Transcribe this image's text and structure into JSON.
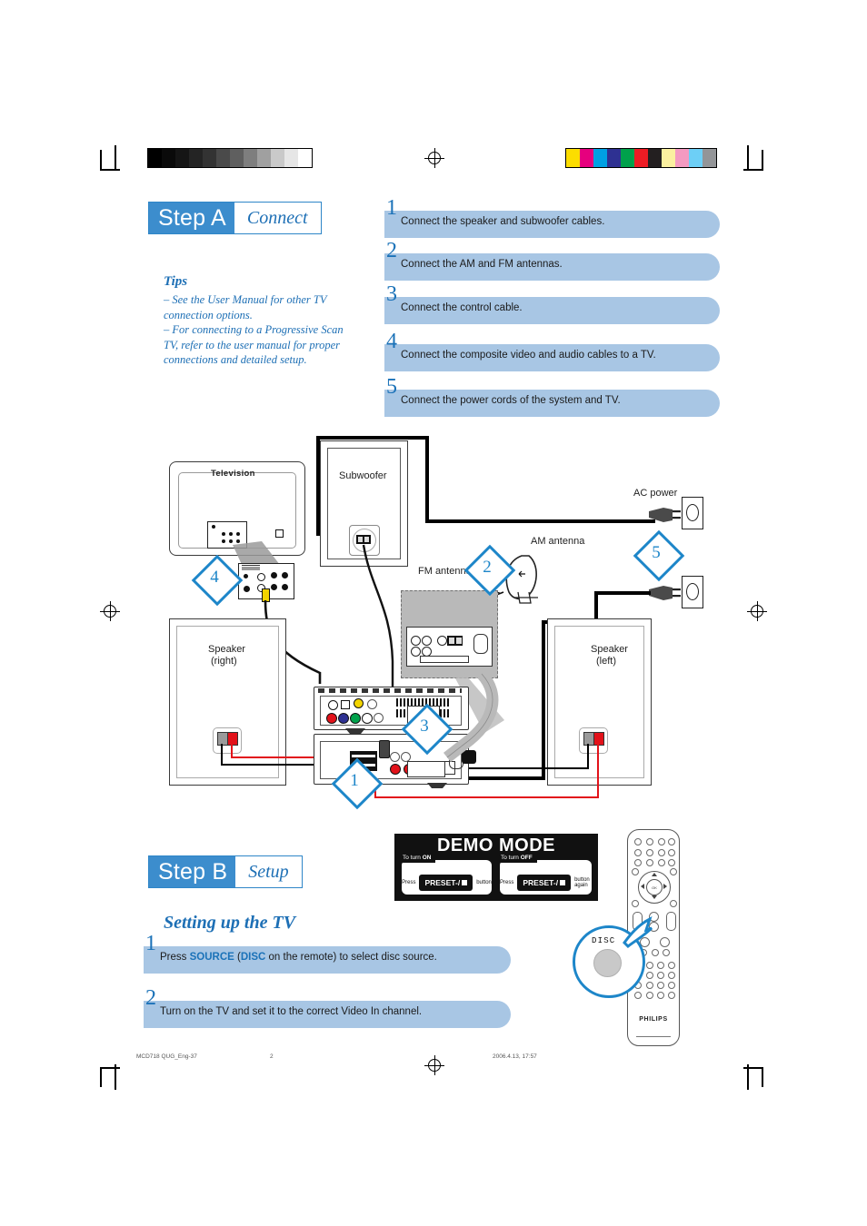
{
  "page": {
    "footer_left": "MCD718 QUG_Eng-37",
    "footer_page": "2",
    "footer_date": "2006.4.13, 17:57"
  },
  "colors": {
    "brand_blue": "#1d6fb5",
    "header_blue": "#3c8dcd",
    "pill_blue": "#a8c6e4",
    "callout_blue": "#1d86c9",
    "wire_red": "#e2121a"
  },
  "calibration": {
    "grayscale": [
      "#000000",
      "#0a0a0a",
      "#151515",
      "#242424",
      "#333333",
      "#4a4a4a",
      "#5f5f5f",
      "#7e7e7e",
      "#a0a0a0",
      "#c9c9c9",
      "#e6e6e6",
      "#ffffff"
    ],
    "colorbars": [
      "#fcdd00",
      "#e6007e",
      "#00a0e3",
      "#2e3192",
      "#00a14b",
      "#ed1c24",
      "#231f20",
      "#fbf0a0",
      "#f49ac1",
      "#6dcff6",
      "#939598"
    ]
  },
  "step_a": {
    "label": "Step A",
    "sub": "Connect",
    "tips_title": "Tips",
    "tips_lines": [
      "–   See the User Manual for other TV",
      "connection options.",
      "–   For connecting to a Progressive Scan",
      "TV, refer to the user manual for proper",
      "connections and detailed setup."
    ],
    "instructions": [
      {
        "num": "1",
        "text": "Connect the speaker and subwoofer cables.",
        "pill_width": 362
      },
      {
        "num": "2",
        "text": "Connect the AM and FM antennas.",
        "pill_width": 362
      },
      {
        "num": "3",
        "text": "Connect the control cable.",
        "pill_width": 362
      },
      {
        "num": "4",
        "text": "Connect the composite video and audio cables to a TV.",
        "pill_width": 362
      },
      {
        "num": "5",
        "text": "Connect the power cords of the system and TV.",
        "pill_width": 362
      }
    ]
  },
  "diagram": {
    "labels": {
      "television": "Television",
      "subwoofer": "Subwoofer",
      "ac_power": "AC power",
      "am_antenna": "AM antenna",
      "fm_antenna": "FM antenna",
      "speaker_right": "Speaker",
      "speaker_right_side": "(right)",
      "speaker_left": "Speaker",
      "speaker_left_side": "(left)"
    },
    "callouts": [
      "1",
      "2",
      "3",
      "4",
      "5"
    ]
  },
  "demo_mode": {
    "title": "DEMO MODE",
    "on": {
      "tag_prefix": "To turn ",
      "tag_state": "ON",
      "press": "Press",
      "key": "PRESET-/",
      "after": "button"
    },
    "off": {
      "tag_prefix": "To turn ",
      "tag_state": "OFF",
      "press": "Press",
      "key": "PRESET-/",
      "after": "button again"
    }
  },
  "step_b": {
    "label": "Step B",
    "sub": "Setup",
    "heading": "Setting up the TV",
    "instructions": [
      {
        "num": "1",
        "pre": "Press ",
        "bold1": "SOURCE",
        "mid": " (",
        "bold2": "DISC",
        "post": " on the remote) to select disc source.",
        "pill_width": 404
      },
      {
        "num": "2",
        "text": "Turn on the TV and set it to the correct Video In channel.",
        "pill_width": 404
      }
    ]
  },
  "remote": {
    "brand": "PHILIPS",
    "disc_callout_label": "DISC"
  }
}
